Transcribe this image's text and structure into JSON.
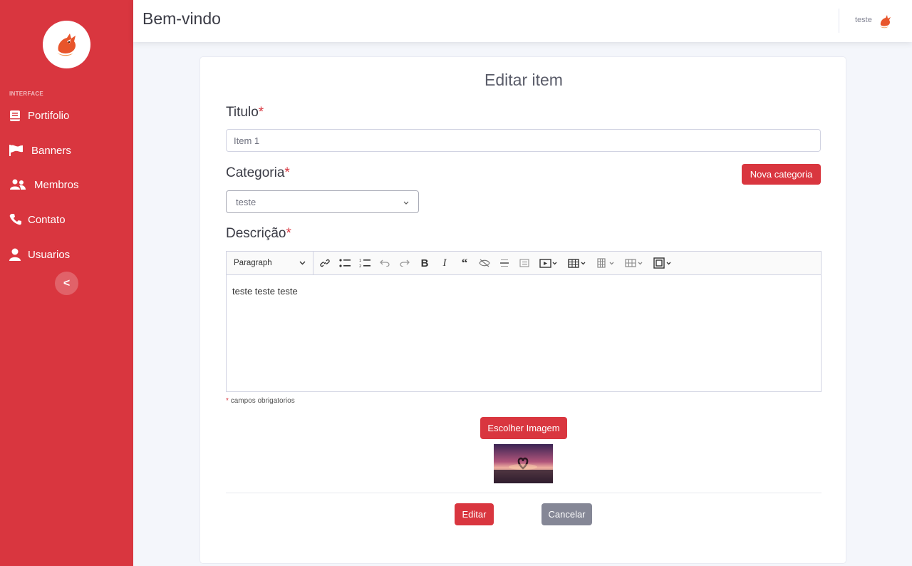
{
  "sidebar": {
    "heading": "INTERFACE",
    "items": [
      {
        "label": "Portifolio",
        "icon": "book-icon"
      },
      {
        "label": "Banners",
        "icon": "flag-icon"
      },
      {
        "label": "Membros",
        "icon": "users-icon"
      },
      {
        "label": "Contato",
        "icon": "phone-icon"
      },
      {
        "label": "Usuarios",
        "icon": "user-icon"
      }
    ],
    "collapse_label": "<"
  },
  "topbar": {
    "title": "Bem-vindo",
    "user_name": "teste"
  },
  "form": {
    "title": "Editar item",
    "titulo_label": "Titulo",
    "required_mark": "*",
    "titulo_value": "Item 1",
    "categoria_label": "Categoria",
    "nova_categoria_button": "Nova categoria",
    "categoria_selected": "teste",
    "descricao_label": "Descrição",
    "editor": {
      "heading_select": "Paragraph",
      "content": "teste teste teste"
    },
    "required_note": "campos obrigatorios",
    "choose_image_button": "Escolher Imagem",
    "edit_button": "Editar",
    "cancel_button": "Cancelar"
  },
  "colors": {
    "primary": "#d9363f",
    "secondary": "#858796",
    "background": "#f4f6fb"
  }
}
